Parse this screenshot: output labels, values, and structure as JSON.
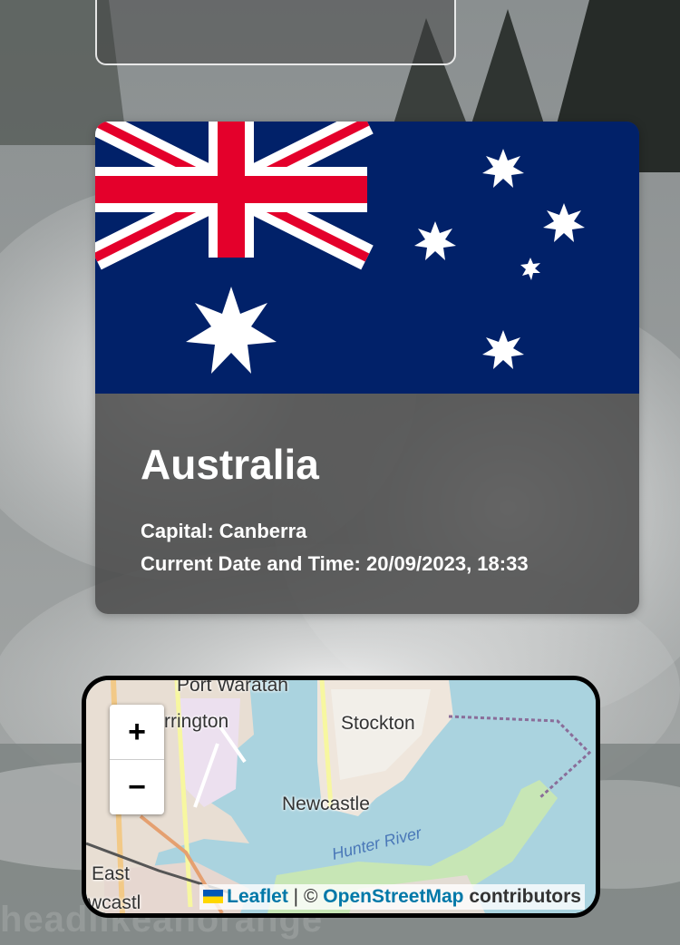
{
  "country": {
    "name": "Australia",
    "capital_line": "Capital: Canberra",
    "datetime_line": "Current Date and Time: 20/09/2023, 18:33"
  },
  "map": {
    "zoom_in": "+",
    "zoom_out": "−",
    "labels": {
      "port": "Port Waratah",
      "warrington": "rrington",
      "stockton": "Stockton",
      "newcastle": "Newcastle",
      "river": "Hunter River",
      "east": "East",
      "newcastle_west": "wcastl"
    },
    "attribution": {
      "leaflet": "Leaflet",
      "separator": "| ©",
      "osm": "OpenStreetMap",
      "contributors": "contributors"
    }
  },
  "background": {
    "watermark": "headlikeanorange"
  },
  "colors": {
    "flag_blue": "#012169",
    "flag_red": "#e4002b",
    "water": "#aad3df",
    "link": "#0078a8"
  }
}
